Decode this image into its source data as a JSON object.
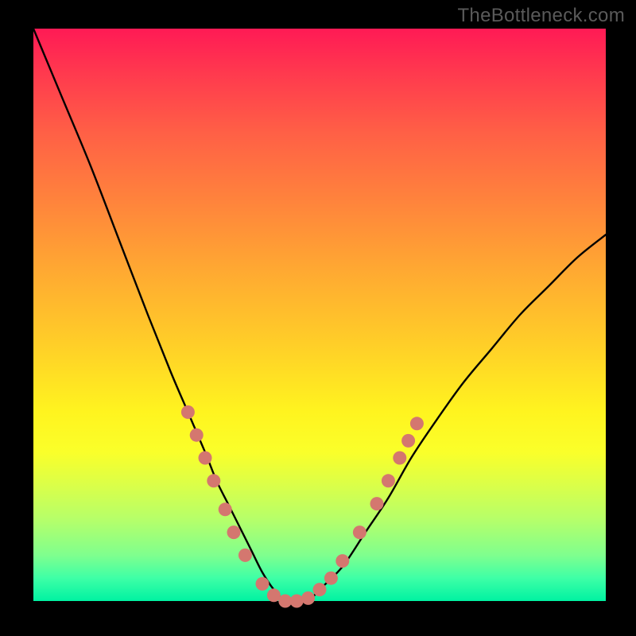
{
  "watermark": "TheBottleneck.com",
  "chart_data": {
    "type": "line",
    "title": "",
    "xlabel": "",
    "ylabel": "",
    "xlim": [
      0,
      100
    ],
    "ylim": [
      0,
      100
    ],
    "grid": false,
    "legend": false,
    "background_gradient": {
      "direction": "vertical",
      "stops": [
        {
          "pos": 0,
          "color": "#ff1a55"
        },
        {
          "pos": 55,
          "color": "#ffce28"
        },
        {
          "pos": 100,
          "color": "#00f2a2"
        }
      ]
    },
    "series": [
      {
        "name": "bottleneck-curve",
        "x": [
          0,
          5,
          10,
          15,
          20,
          24,
          27,
          30,
          32,
          34,
          36,
          38,
          40,
          42,
          44,
          46,
          48,
          50,
          54,
          58,
          62,
          66,
          70,
          75,
          80,
          85,
          90,
          95,
          100
        ],
        "y": [
          100,
          88,
          76,
          63,
          50,
          40,
          33,
          26,
          21,
          17,
          13,
          9,
          5,
          2,
          0,
          0,
          0,
          2,
          6,
          12,
          18,
          25,
          31,
          38,
          44,
          50,
          55,
          60,
          64
        ]
      }
    ],
    "annotations": {
      "markers": {
        "name": "highlight-dots",
        "color": "#d4776f",
        "points": [
          {
            "x": 27,
            "y": 33
          },
          {
            "x": 28.5,
            "y": 29
          },
          {
            "x": 30,
            "y": 25
          },
          {
            "x": 31.5,
            "y": 21
          },
          {
            "x": 33.5,
            "y": 16
          },
          {
            "x": 35,
            "y": 12
          },
          {
            "x": 37,
            "y": 8
          },
          {
            "x": 40,
            "y": 3
          },
          {
            "x": 42,
            "y": 1
          },
          {
            "x": 44,
            "y": 0
          },
          {
            "x": 46,
            "y": 0
          },
          {
            "x": 48,
            "y": 0.5
          },
          {
            "x": 50,
            "y": 2
          },
          {
            "x": 52,
            "y": 4
          },
          {
            "x": 54,
            "y": 7
          },
          {
            "x": 57,
            "y": 12
          },
          {
            "x": 60,
            "y": 17
          },
          {
            "x": 62,
            "y": 21
          },
          {
            "x": 64,
            "y": 25
          },
          {
            "x": 65.5,
            "y": 28
          },
          {
            "x": 67,
            "y": 31
          }
        ]
      }
    }
  }
}
